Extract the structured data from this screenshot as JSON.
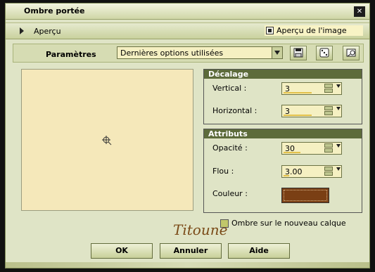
{
  "window": {
    "title": "Ombre portée"
  },
  "preview": {
    "section_label": "Aperçu",
    "image_preview_label": "Aperçu de l'image"
  },
  "params": {
    "label": "Paramètres",
    "preset_value": "Dernières options utilisées"
  },
  "offset_group": {
    "title": "Décalage",
    "vertical_label": "Vertical :",
    "vertical_value": "3",
    "horizontal_label": "Horizontal :",
    "horizontal_value": "3"
  },
  "attributes_group": {
    "title": "Attributs",
    "opacity_label": "Opacité :",
    "opacity_value": "30",
    "blur_label": "Flou :",
    "blur_value": "3.00",
    "color_label": "Couleur :",
    "color_hex": "#7a3f14"
  },
  "new_layer_label": "Ombre sur le nouveau calque",
  "signature": "Titoune",
  "buttons": {
    "ok": "OK",
    "cancel": "Annuler",
    "help": "Aide"
  },
  "colors": {
    "frame": "#dfe4c6",
    "preview_bg": "#f5e8ba",
    "group_header": "#5d6b3a"
  }
}
